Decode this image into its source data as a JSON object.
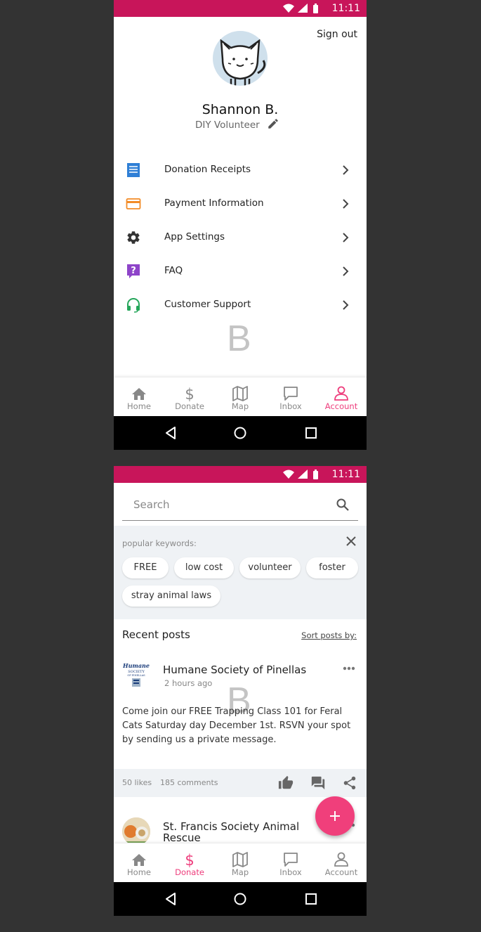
{
  "status_bar": {
    "time": "11:11"
  },
  "watermark": "B",
  "account_screen": {
    "sign_out": "Sign out",
    "user_name": "Shannon B.",
    "user_role": "DIY Volunteer",
    "menu": [
      {
        "label": "Donation Receipts",
        "icon": "receipt-icon",
        "color": "#2f7fd6"
      },
      {
        "label": "Payment Information",
        "icon": "credit-card-icon",
        "color": "#f28c28"
      },
      {
        "label": "App Settings",
        "icon": "gear-icon",
        "color": "#333333"
      },
      {
        "label": "FAQ",
        "icon": "question-icon",
        "color": "#8e44c9"
      },
      {
        "label": "Customer Support",
        "icon": "headset-icon",
        "color": "#26a65b"
      }
    ],
    "active_tab": "Account"
  },
  "tabs": [
    "Home",
    "Donate",
    "Map",
    "Inbox",
    "Account"
  ],
  "feed_screen": {
    "search_placeholder": "Search",
    "keywords_title": "popular keywords:",
    "keywords": [
      "FREE",
      "low cost",
      "volunteer",
      "foster",
      "stray animal laws"
    ],
    "recent_posts": "Recent posts",
    "sort_by": "Sort posts by:",
    "posts": [
      {
        "org": "Humane Society of Pinellas",
        "time": "2 hours ago",
        "body": "Come join our FREE Trapping Class 101 for Feral Cats Saturday day December 1st. RSVN your spot by sending us a private message.",
        "likes": "50 likes",
        "comments": "185 comments",
        "logo_text": "Humane Society of Pinellas"
      },
      {
        "org": "St. Francis Society Animal Rescue"
      }
    ],
    "active_tab": "Donate"
  },
  "colors": {
    "accent": "#ee3d7c",
    "status_bar": "#c8155a",
    "fab": "#f03f7b"
  }
}
